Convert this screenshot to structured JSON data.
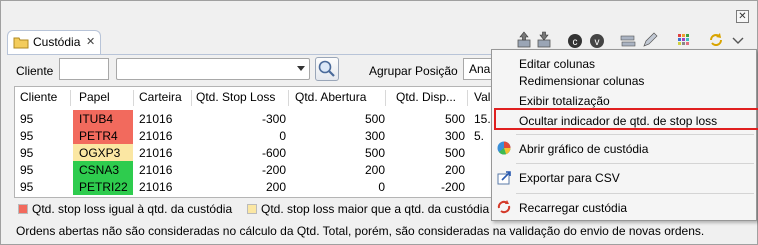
{
  "view": {
    "tab_title": "Custódia",
    "close_tab_glyph": "⌘",
    "close_window_glyph": "✕"
  },
  "toolbar": {
    "icons": [
      "buy-order-icon",
      "sell-order-icon",
      "buy-c-icon",
      "sell-v-icon",
      "transfer-icon",
      "edit-icon",
      "grid-colors-icon",
      "refresh-icon",
      "view-menu-icon"
    ]
  },
  "filters": {
    "cliente_label": "Cliente",
    "cliente_value": "",
    "conta_value": "",
    "agrupar_label": "Agrupar Posição",
    "agrupar_value": "Anal"
  },
  "grid": {
    "columns": [
      "Cliente",
      "Papel",
      "Carteira",
      "Qtd. Stop Loss",
      "Qtd. Abertura",
      "Qtd. Disp...",
      "Valo"
    ],
    "rows": [
      {
        "cliente": "95",
        "papel": "ITUB4",
        "carteira": "21016",
        "stop": "-300",
        "abertura": "500",
        "disp": "500",
        "valor": "15.",
        "status": "equal"
      },
      {
        "cliente": "95",
        "papel": "PETR4",
        "carteira": "21016",
        "stop": "0",
        "abertura": "300",
        "disp": "300",
        "valor": "5.",
        "status": "equal"
      },
      {
        "cliente": "95",
        "papel": "OGXP3",
        "carteira": "21016",
        "stop": "-600",
        "abertura": "500",
        "disp": "500",
        "valor": "",
        "status": "greater"
      },
      {
        "cliente": "95",
        "papel": "CSNA3",
        "carteira": "21016",
        "stop": "-200",
        "abertura": "200",
        "disp": "200",
        "valor": "",
        "status": "ok"
      },
      {
        "cliente": "95",
        "papel": "PETRI22",
        "carteira": "21016",
        "stop": "200",
        "abertura": "0",
        "disp": "-200",
        "valor": "",
        "status": "ok"
      }
    ]
  },
  "status_colors": {
    "equal": "#f26a5d",
    "greater": "#fbe7a3",
    "ok": "#2ecc4e"
  },
  "legend": {
    "equal_label": "Qtd. stop loss igual à qtd. da custódia",
    "greater_label": "Qtd. stop loss maior que a qtd. da custódia"
  },
  "footnote": "Ordens abertas não são consideradas no cálculo da Qtd. Total, porém, são consideradas na validação do envio de novas ordens.",
  "menu": {
    "items": [
      {
        "label": "Editar colunas",
        "icon": ""
      },
      {
        "label": "Redimensionar colunas",
        "icon": ""
      },
      {
        "label": "Exibir totalização",
        "icon": ""
      },
      {
        "label": "Ocultar indicador de qtd. de stop loss",
        "icon": "",
        "highlighted": true
      },
      {
        "label": "Abrir gráfico de custódia",
        "icon": "pie-chart-icon"
      },
      {
        "label": "Exportar para CSV",
        "icon": "export-icon"
      },
      {
        "label": "Recarregar custódia",
        "icon": "reload-icon"
      }
    ],
    "highlight_color": "#e02020"
  }
}
